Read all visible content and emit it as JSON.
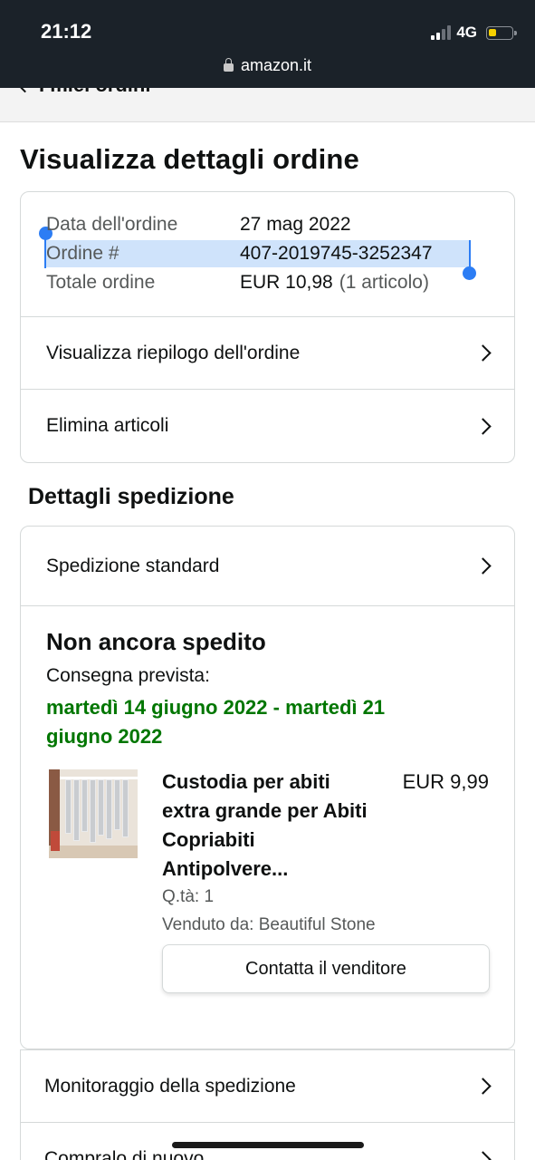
{
  "status_bar": {
    "time": "21:12",
    "network": "4G",
    "url": "amazon.it"
  },
  "back_nav": {
    "label": "I miei ordini"
  },
  "page_title": "Visualizza dettagli ordine",
  "order_info": {
    "date_label": "Data dell'ordine",
    "date_value": "27 mag 2022",
    "number_label": "Ordine #",
    "number_value": "407-2019745-3252347",
    "total_label": "Totale ordine",
    "total_value": "EUR 10,98",
    "total_count": "(1 articolo)"
  },
  "order_links": [
    {
      "label": "Visualizza riepilogo dell'ordine"
    },
    {
      "label": "Elimina articoli"
    }
  ],
  "shipping": {
    "section_title": "Dettagli spedizione",
    "method": "Spedizione standard",
    "status": "Non ancora spedito",
    "delivery_label": "Consegna prevista:",
    "delivery_date": "martedì 14 giugno 2022 - martedì 21 giugno 2022",
    "item": {
      "title": "Custodia per abiti extra grande per Abiti Copriabiti Antipolvere...",
      "price": "EUR 9,99",
      "quantity": "Q.tà: 1",
      "seller": "Venduto da: Beautiful Stone",
      "contact_button": "Contatta il venditore"
    }
  },
  "bottom_links": [
    {
      "label": "Monitoraggio della spedizione"
    },
    {
      "label": "Compralo di nuovo"
    }
  ],
  "colors": {
    "status_bar_bg": "#1b2229",
    "delivery_green": "#007600",
    "selection_blue": "#2c7df4",
    "selection_fill": "#cfe3fb",
    "battery_yellow": "#f5d000"
  }
}
